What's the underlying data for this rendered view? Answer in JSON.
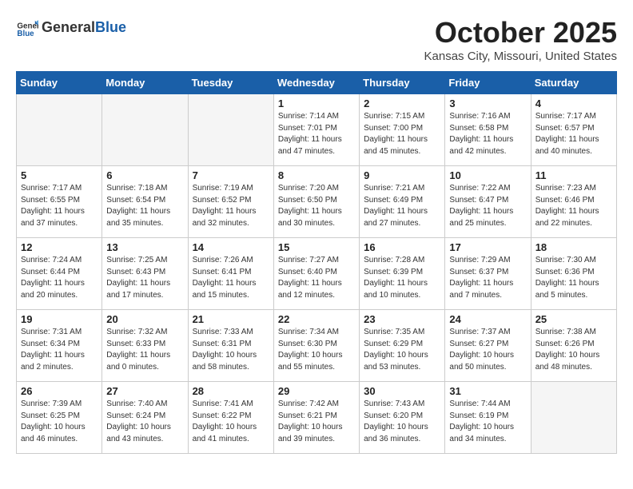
{
  "header": {
    "logo_general": "General",
    "logo_blue": "Blue",
    "month": "October 2025",
    "location": "Kansas City, Missouri, United States"
  },
  "weekdays": [
    "Sunday",
    "Monday",
    "Tuesday",
    "Wednesday",
    "Thursday",
    "Friday",
    "Saturday"
  ],
  "weeks": [
    [
      {
        "day": "",
        "empty": true
      },
      {
        "day": "",
        "empty": true
      },
      {
        "day": "",
        "empty": true
      },
      {
        "day": "1",
        "sunrise": "7:14 AM",
        "sunset": "7:01 PM",
        "daylight": "11 hours and 47 minutes."
      },
      {
        "day": "2",
        "sunrise": "7:15 AM",
        "sunset": "7:00 PM",
        "daylight": "11 hours and 45 minutes."
      },
      {
        "day": "3",
        "sunrise": "7:16 AM",
        "sunset": "6:58 PM",
        "daylight": "11 hours and 42 minutes."
      },
      {
        "day": "4",
        "sunrise": "7:17 AM",
        "sunset": "6:57 PM",
        "daylight": "11 hours and 40 minutes."
      }
    ],
    [
      {
        "day": "5",
        "sunrise": "7:17 AM",
        "sunset": "6:55 PM",
        "daylight": "11 hours and 37 minutes."
      },
      {
        "day": "6",
        "sunrise": "7:18 AM",
        "sunset": "6:54 PM",
        "daylight": "11 hours and 35 minutes."
      },
      {
        "day": "7",
        "sunrise": "7:19 AM",
        "sunset": "6:52 PM",
        "daylight": "11 hours and 32 minutes."
      },
      {
        "day": "8",
        "sunrise": "7:20 AM",
        "sunset": "6:50 PM",
        "daylight": "11 hours and 30 minutes."
      },
      {
        "day": "9",
        "sunrise": "7:21 AM",
        "sunset": "6:49 PM",
        "daylight": "11 hours and 27 minutes."
      },
      {
        "day": "10",
        "sunrise": "7:22 AM",
        "sunset": "6:47 PM",
        "daylight": "11 hours and 25 minutes."
      },
      {
        "day": "11",
        "sunrise": "7:23 AM",
        "sunset": "6:46 PM",
        "daylight": "11 hours and 22 minutes."
      }
    ],
    [
      {
        "day": "12",
        "sunrise": "7:24 AM",
        "sunset": "6:44 PM",
        "daylight": "11 hours and 20 minutes."
      },
      {
        "day": "13",
        "sunrise": "7:25 AM",
        "sunset": "6:43 PM",
        "daylight": "11 hours and 17 minutes."
      },
      {
        "day": "14",
        "sunrise": "7:26 AM",
        "sunset": "6:41 PM",
        "daylight": "11 hours and 15 minutes."
      },
      {
        "day": "15",
        "sunrise": "7:27 AM",
        "sunset": "6:40 PM",
        "daylight": "11 hours and 12 minutes."
      },
      {
        "day": "16",
        "sunrise": "7:28 AM",
        "sunset": "6:39 PM",
        "daylight": "11 hours and 10 minutes."
      },
      {
        "day": "17",
        "sunrise": "7:29 AM",
        "sunset": "6:37 PM",
        "daylight": "11 hours and 7 minutes."
      },
      {
        "day": "18",
        "sunrise": "7:30 AM",
        "sunset": "6:36 PM",
        "daylight": "11 hours and 5 minutes."
      }
    ],
    [
      {
        "day": "19",
        "sunrise": "7:31 AM",
        "sunset": "6:34 PM",
        "daylight": "11 hours and 2 minutes."
      },
      {
        "day": "20",
        "sunrise": "7:32 AM",
        "sunset": "6:33 PM",
        "daylight": "11 hours and 0 minutes."
      },
      {
        "day": "21",
        "sunrise": "7:33 AM",
        "sunset": "6:31 PM",
        "daylight": "10 hours and 58 minutes."
      },
      {
        "day": "22",
        "sunrise": "7:34 AM",
        "sunset": "6:30 PM",
        "daylight": "10 hours and 55 minutes."
      },
      {
        "day": "23",
        "sunrise": "7:35 AM",
        "sunset": "6:29 PM",
        "daylight": "10 hours and 53 minutes."
      },
      {
        "day": "24",
        "sunrise": "7:37 AM",
        "sunset": "6:27 PM",
        "daylight": "10 hours and 50 minutes."
      },
      {
        "day": "25",
        "sunrise": "7:38 AM",
        "sunset": "6:26 PM",
        "daylight": "10 hours and 48 minutes."
      }
    ],
    [
      {
        "day": "26",
        "sunrise": "7:39 AM",
        "sunset": "6:25 PM",
        "daylight": "10 hours and 46 minutes."
      },
      {
        "day": "27",
        "sunrise": "7:40 AM",
        "sunset": "6:24 PM",
        "daylight": "10 hours and 43 minutes."
      },
      {
        "day": "28",
        "sunrise": "7:41 AM",
        "sunset": "6:22 PM",
        "daylight": "10 hours and 41 minutes."
      },
      {
        "day": "29",
        "sunrise": "7:42 AM",
        "sunset": "6:21 PM",
        "daylight": "10 hours and 39 minutes."
      },
      {
        "day": "30",
        "sunrise": "7:43 AM",
        "sunset": "6:20 PM",
        "daylight": "10 hours and 36 minutes."
      },
      {
        "day": "31",
        "sunrise": "7:44 AM",
        "sunset": "6:19 PM",
        "daylight": "10 hours and 34 minutes."
      },
      {
        "day": "",
        "empty": true
      }
    ]
  ]
}
